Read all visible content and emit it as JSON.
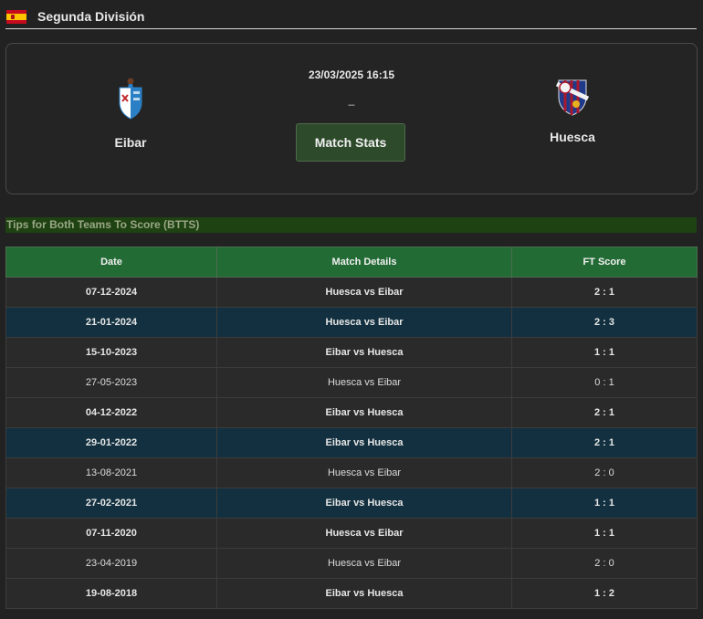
{
  "league": {
    "name": "Segunda División",
    "flag_icon": "spain-flag-icon"
  },
  "match": {
    "datetime": "23/03/2025 16:15",
    "score": "_",
    "home_team": "Eibar",
    "away_team": "Huesca",
    "stats_button": "Match Stats"
  },
  "section": {
    "title": "Tips for Both Teams To Score (BTTS)"
  },
  "table": {
    "headers": [
      "Date",
      "Match Details",
      "FT Score"
    ],
    "rows": [
      {
        "date": "07-12-2024",
        "match": "Huesca vs Eibar",
        "score": "2 : 1",
        "bold": true,
        "btts": false
      },
      {
        "date": "21-01-2024",
        "match": "Huesca vs Eibar",
        "score": "2 : 3",
        "bold": true,
        "btts": true
      },
      {
        "date": "15-10-2023",
        "match": "Eibar vs Huesca",
        "score": "1 : 1",
        "bold": true,
        "btts": false
      },
      {
        "date": "27-05-2023",
        "match": "Huesca vs Eibar",
        "score": "0 : 1",
        "bold": false,
        "btts": false
      },
      {
        "date": "04-12-2022",
        "match": "Eibar vs Huesca",
        "score": "2 : 1",
        "bold": true,
        "btts": false
      },
      {
        "date": "29-01-2022",
        "match": "Eibar vs Huesca",
        "score": "2 : 1",
        "bold": true,
        "btts": true
      },
      {
        "date": "13-08-2021",
        "match": "Huesca vs Eibar",
        "score": "2 : 0",
        "bold": false,
        "btts": false
      },
      {
        "date": "27-02-2021",
        "match": "Eibar vs Huesca",
        "score": "1 : 1",
        "bold": true,
        "btts": true
      },
      {
        "date": "07-11-2020",
        "match": "Huesca vs Eibar",
        "score": "1 : 1",
        "bold": true,
        "btts": false
      },
      {
        "date": "23-04-2019",
        "match": "Huesca vs Eibar",
        "score": "2 : 0",
        "bold": false,
        "btts": false
      },
      {
        "date": "19-08-2018",
        "match": "Eibar vs Huesca",
        "score": "1 : 2",
        "bold": true,
        "btts": false
      }
    ]
  },
  "colors": {
    "header_green": "#236b35",
    "btts_row": "#12303f",
    "dark_row": "#2a2a2a",
    "section_bar": "#1f4213"
  }
}
